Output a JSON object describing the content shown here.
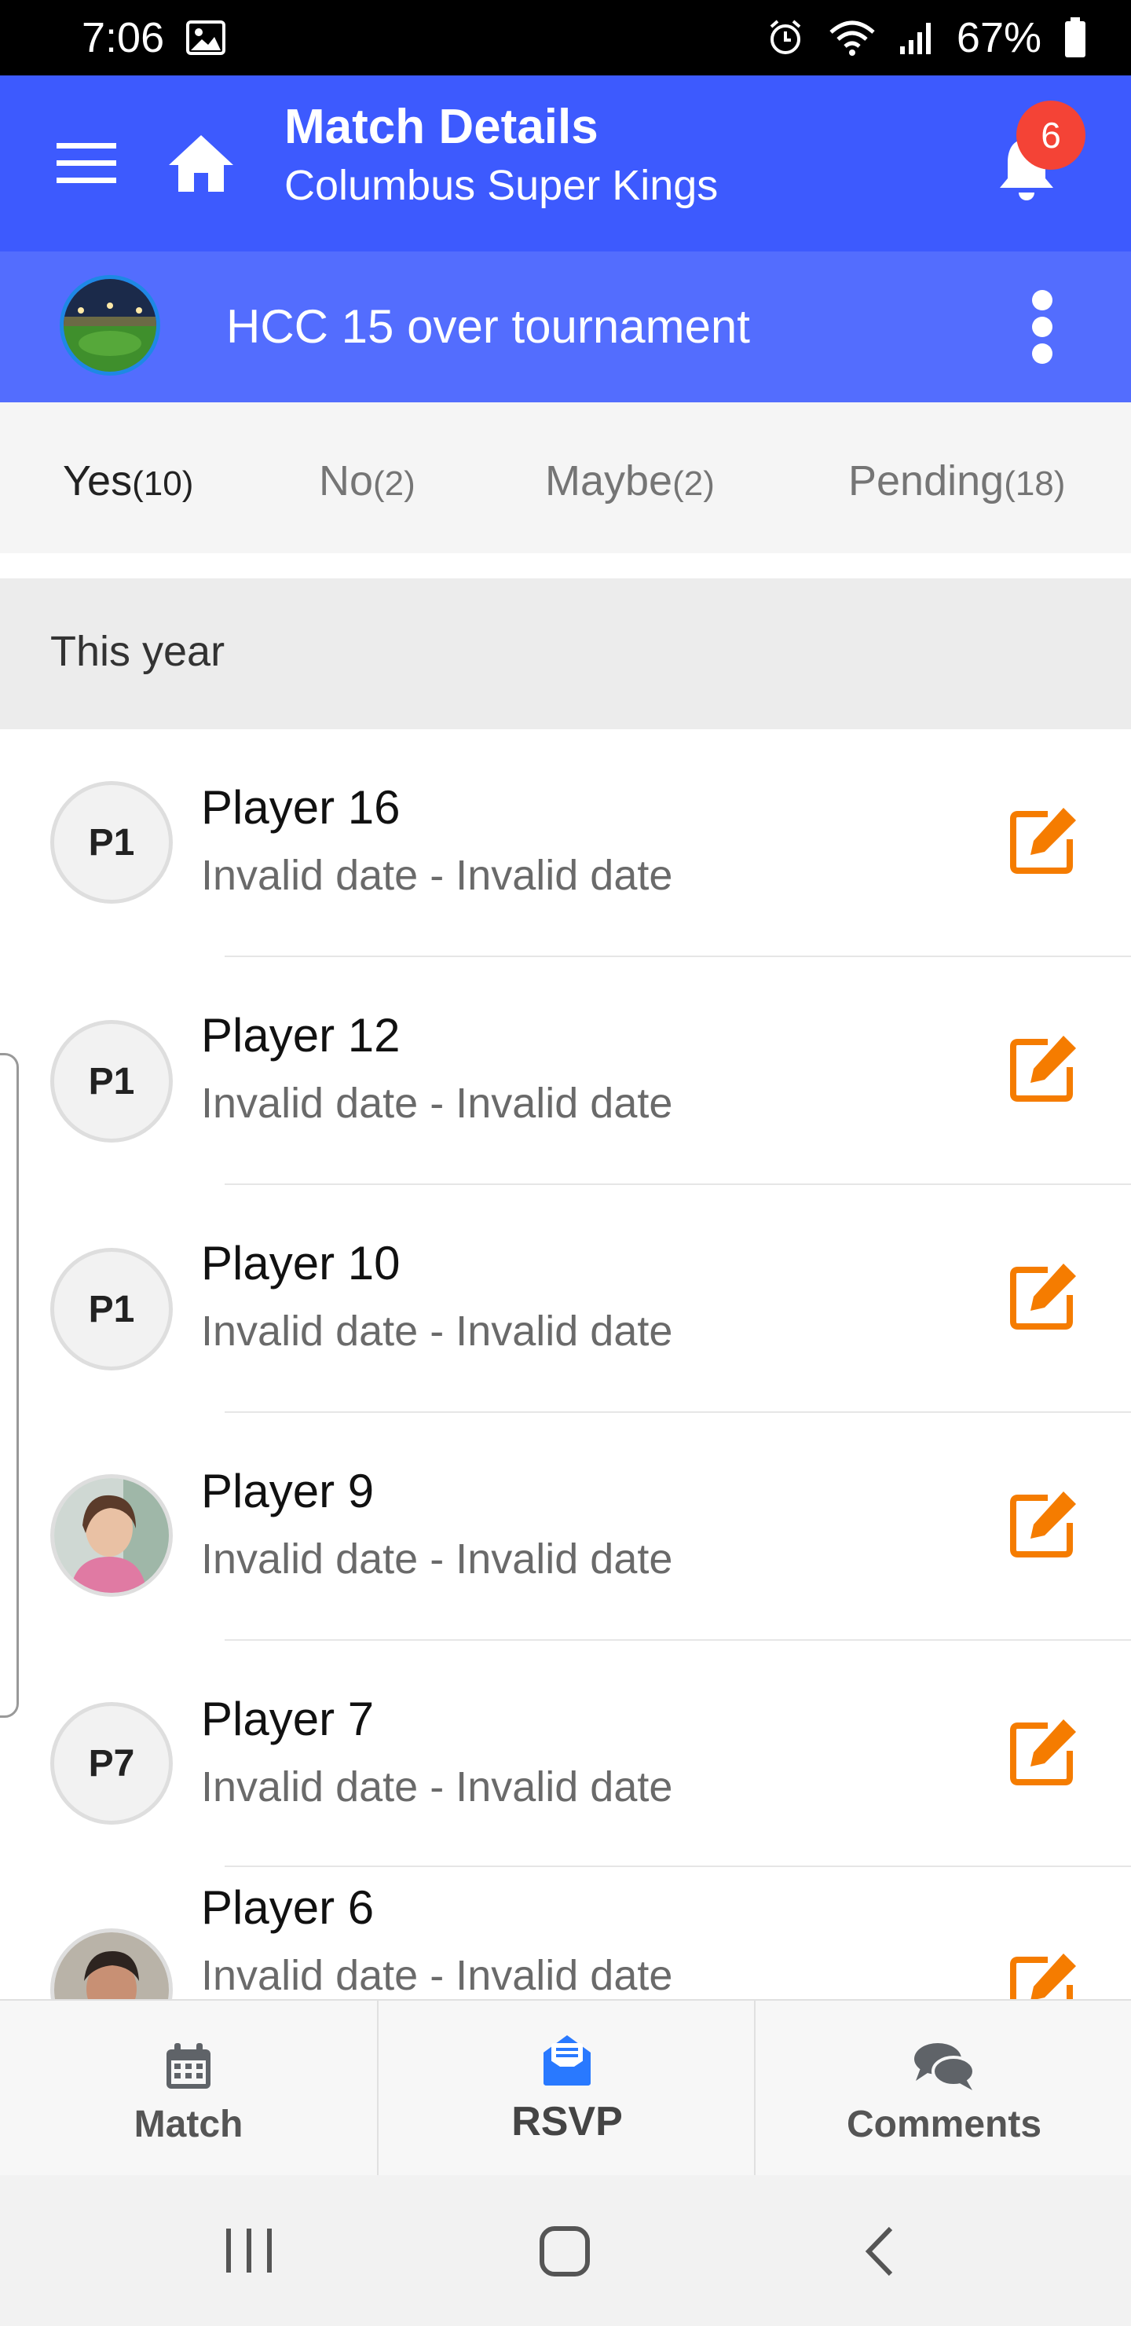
{
  "status_bar": {
    "time": "7:06",
    "battery": "67%"
  },
  "app_bar": {
    "title": "Match Details",
    "subtitle": "Columbus Super Kings",
    "notification_count": "6",
    "menu_icon": "menu-icon",
    "home_icon": "home-icon",
    "bell_icon": "bell-icon"
  },
  "tournament": {
    "name": "HCC 15 over tournament",
    "more_icon": "more-vertical-icon"
  },
  "tabs": [
    {
      "label": "Yes",
      "count": "(10)"
    },
    {
      "label": "No",
      "count": "(2)"
    },
    {
      "label": "Maybe",
      "count": "(2)"
    },
    {
      "label": "Pending",
      "count": "(18)"
    }
  ],
  "section": {
    "title": "This year"
  },
  "players": [
    {
      "name": "Player 16",
      "dates": "Invalid date - Invalid date",
      "initials": "P1"
    },
    {
      "name": "Player 12",
      "dates": "Invalid date - Invalid date",
      "initials": "P1"
    },
    {
      "name": "Player 10",
      "dates": "Invalid date - Invalid date",
      "initials": "P1"
    },
    {
      "name": "Player 9",
      "dates": "Invalid date - Invalid date",
      "initials": ""
    },
    {
      "name": "Player 7",
      "dates": "Invalid date - Invalid date",
      "initials": "P7"
    },
    {
      "name": "Player 6",
      "dates": "Invalid date - Invalid date",
      "initials": ""
    }
  ],
  "bottom_nav": [
    {
      "label": "Match",
      "icon": "calendar-icon"
    },
    {
      "label": "RSVP",
      "icon": "rsvp-mail-icon"
    },
    {
      "label": "Comments",
      "icon": "comments-icon"
    }
  ],
  "colors": {
    "primary": "#3d5afe",
    "secondary": "#536dfe",
    "accent_edit": "#f57c00",
    "badge": "#f44336"
  }
}
